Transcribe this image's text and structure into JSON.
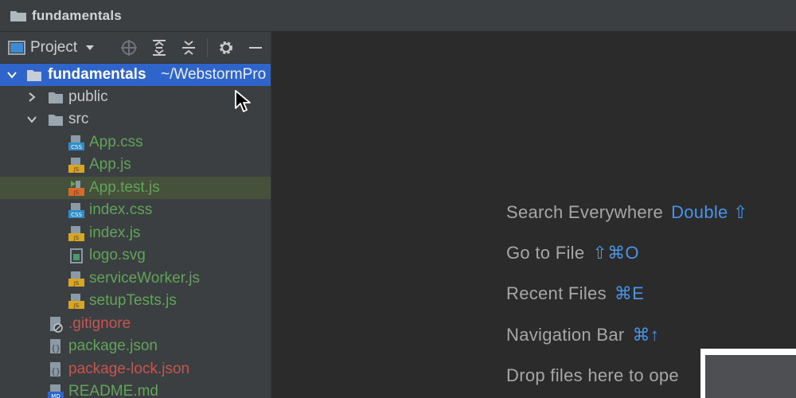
{
  "window": {
    "title": "fundamentals"
  },
  "panel": {
    "title": "Project"
  },
  "tree": {
    "root": {
      "name": "fundamentals",
      "path": "~/WebstormPro"
    },
    "public": "public",
    "src": "src",
    "files": [
      {
        "name": "App.css"
      },
      {
        "name": "App.js"
      },
      {
        "name": "App.test.js"
      },
      {
        "name": "index.css"
      },
      {
        "name": "index.js"
      },
      {
        "name": "logo.svg"
      },
      {
        "name": "serviceWorker.js"
      },
      {
        "name": "setupTests.js"
      }
    ],
    "root_files": [
      {
        "name": ".gitignore"
      },
      {
        "name": "package.json"
      },
      {
        "name": "package-lock.json"
      },
      {
        "name": "README.md"
      }
    ]
  },
  "hints": [
    {
      "label": "Search Everywhere",
      "key": "Double ⇧"
    },
    {
      "label": "Go to File",
      "key": "⇧⌘O"
    },
    {
      "label": "Recent Files",
      "key": "⌘E"
    },
    {
      "label": "Navigation Bar",
      "key": "⌘↑"
    },
    {
      "label": "Drop files here to ope"
    }
  ],
  "colors": {
    "selection": "#2f65ca",
    "test_highlight": "#45513a",
    "added_file": "#62a35a",
    "ignored_file": "#c75450",
    "shortcut": "#4a93e6"
  },
  "icons": {
    "folder": "folder-icon",
    "css": "css-file-icon",
    "js": "js-file-icon",
    "json": "json-file-icon",
    "svg": "image-file-icon",
    "ignore": "ignore-file-icon",
    "md": "markdown-file-icon"
  }
}
